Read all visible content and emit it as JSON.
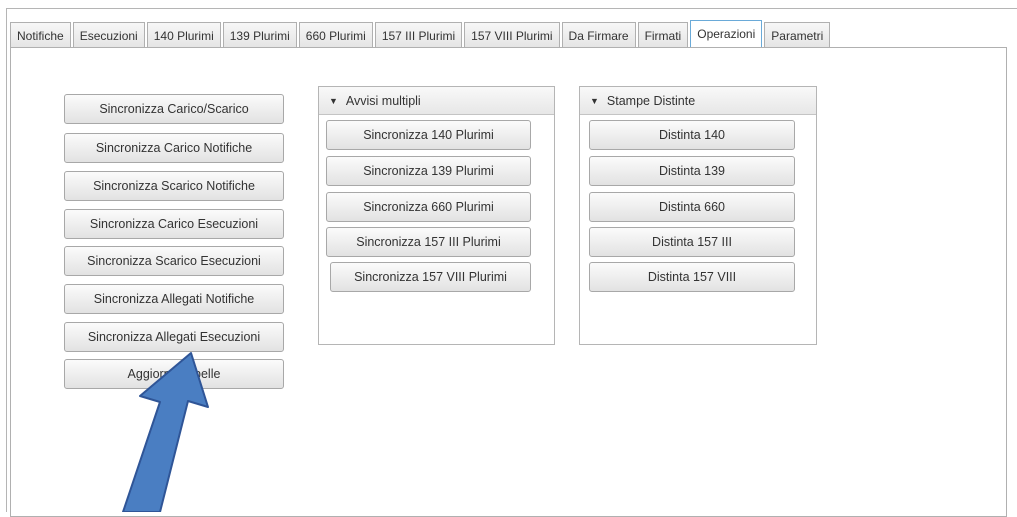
{
  "tabs": [
    {
      "label": "Notifiche"
    },
    {
      "label": "Esecuzioni"
    },
    {
      "label": "140 Plurimi"
    },
    {
      "label": "139 Plurimi"
    },
    {
      "label": "660 Plurimi"
    },
    {
      "label": "157 III Plurimi"
    },
    {
      "label": "157 VIII Plurimi"
    },
    {
      "label": "Da Firmare"
    },
    {
      "label": "Firmati"
    },
    {
      "label": "Operazioni",
      "active": true
    },
    {
      "label": "Parametri"
    }
  ],
  "sync_buttons": [
    "Sincronizza Carico/Scarico",
    "Sincronizza Carico Notifiche",
    "Sincronizza Scarico Notifiche",
    "Sincronizza Carico Esecuzioni",
    "Sincronizza Scarico Esecuzioni",
    "Sincronizza Allegati Notifiche",
    "Sincronizza Allegati Esecuzioni",
    "Aggiorna Tabelle"
  ],
  "avvisi_panel": {
    "title": "Avvisi multipli",
    "buttons": [
      "Sincronizza 140 Plurimi",
      "Sincronizza 139 Plurimi",
      "Sincronizza 660 Plurimi",
      "Sincronizza 157 III Plurimi",
      "Sincronizza 157 VIII Plurimi"
    ]
  },
  "stampe_panel": {
    "title": "Stampe Distinte",
    "buttons": [
      "Distinta 140",
      "Distinta 139",
      "Distinta 660",
      "Distinta 157 III",
      "Distinta 157 VIII"
    ]
  },
  "icons": {
    "collapse": "triangle-down-icon",
    "annotation": "blue-arrow-icon"
  },
  "colors": {
    "accent_tab_border": "#6aaad8",
    "arrow_fill": "#4a7ec2",
    "arrow_stroke": "#2f5597"
  }
}
